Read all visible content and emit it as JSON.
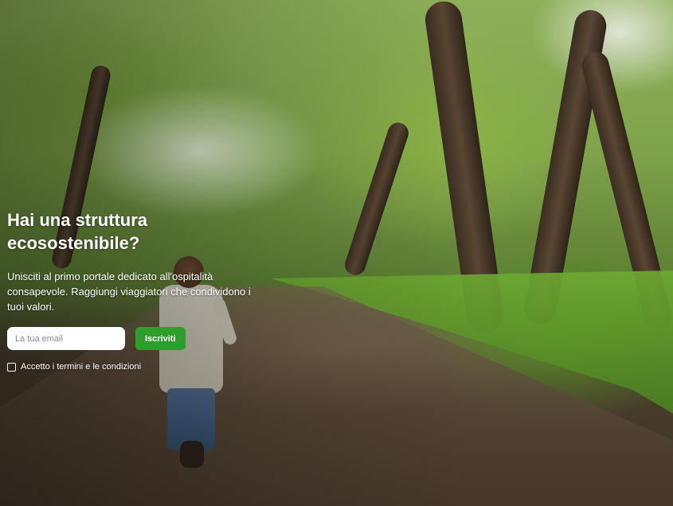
{
  "hero": {
    "background_description": "forest-path-photo",
    "headline": "Hai una struttura ecosostenibile?",
    "lead": "Unisciti al primo portale dedicato all'ospitalità consapevole. Raggiungi viaggiatori che condividono i tuoi valori."
  },
  "signup": {
    "email_placeholder": "La tua email",
    "email_value": "",
    "submit_label": "Iscriviti",
    "terms_label": "Accetto i termini e le condizioni",
    "terms_checked": false
  },
  "colors": {
    "accent": "#2e9e2a",
    "text": "#ffffff",
    "input_bg": "#ffffff"
  }
}
